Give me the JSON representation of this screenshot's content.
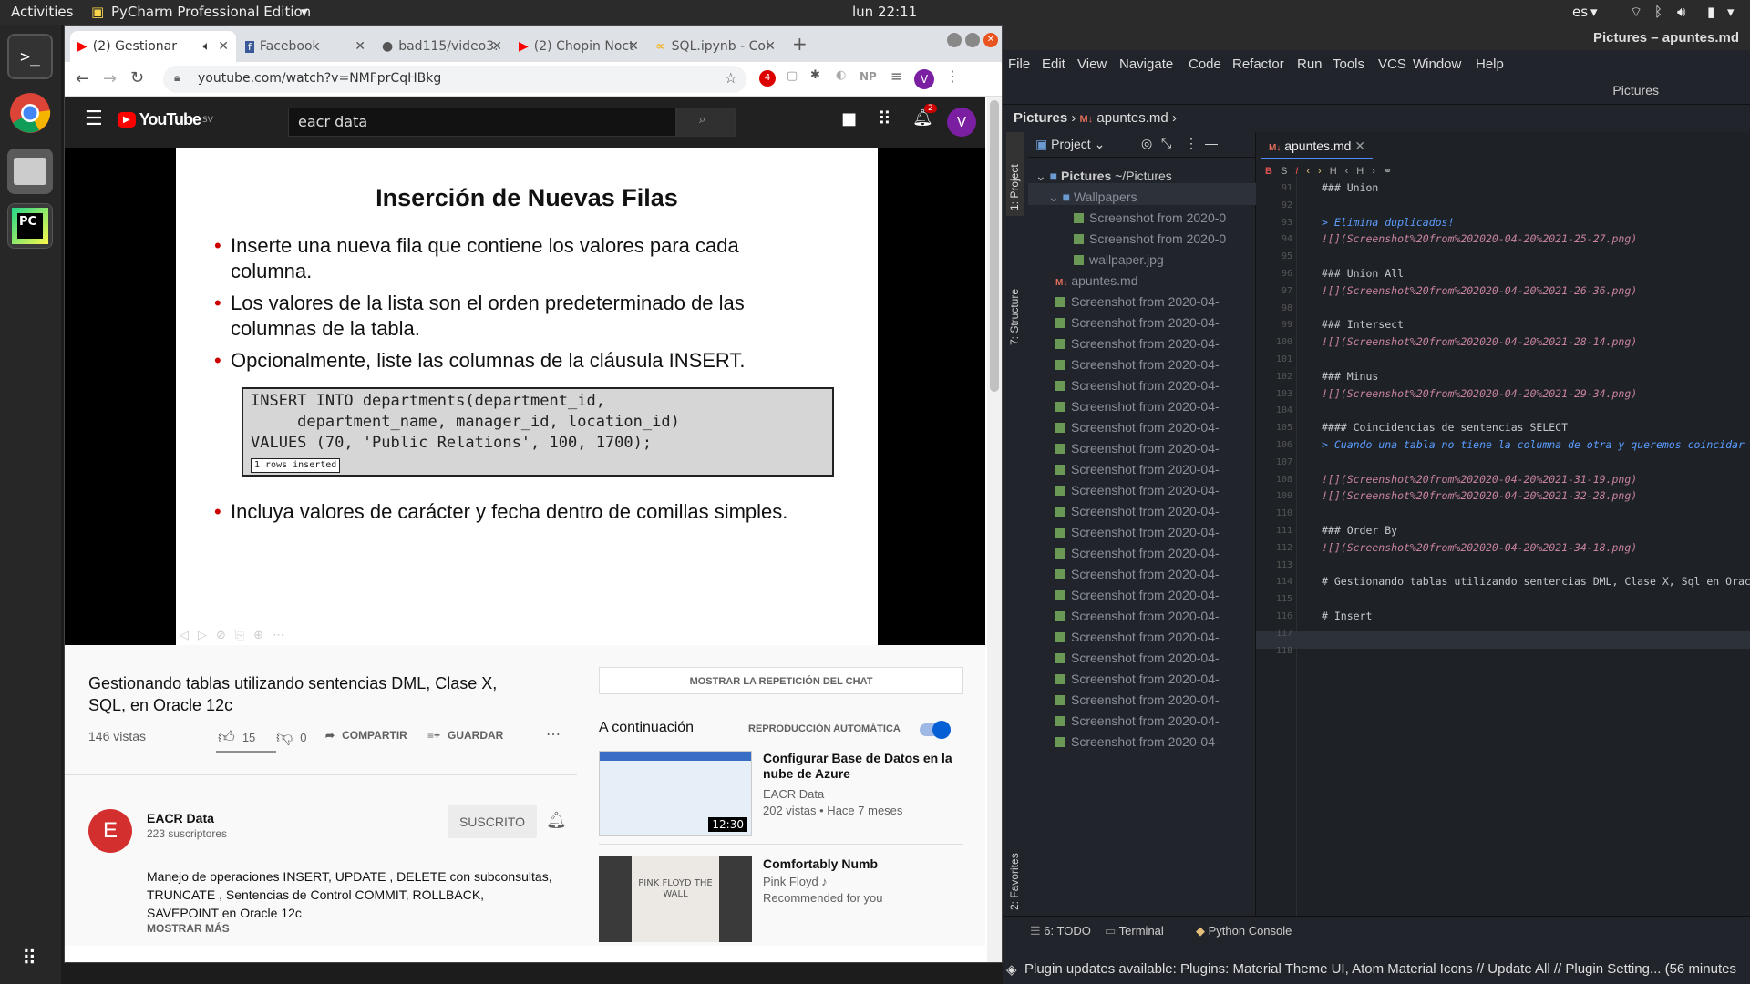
{
  "topbar": {
    "activities": "Activities",
    "app": "PyCharm Professional Edition",
    "clock": "lun 22:11",
    "lang": "es"
  },
  "chrome": {
    "tabs": [
      {
        "label": "(2) Gestionar"
      },
      {
        "label": "Facebook"
      },
      {
        "label": "bad115/video3."
      },
      {
        "label": "(2) Chopin Noct"
      },
      {
        "label": "SQL.ipynb - Col"
      }
    ],
    "url": "youtube.com/watch?v=NMFprCqHBkg",
    "ext_badge": "4",
    "ext_np": "NP",
    "avatar": "V"
  },
  "youtube": {
    "logo": "YouTube",
    "logo_sup": "SV",
    "search_value": "eacr data",
    "notif_count": "2",
    "slide": {
      "title": "Inserción de Nuevas Filas",
      "bullets": [
        "Inserte una nueva fila que contiene los valores para cada columna.",
        "Los valores de la lista son el orden predeterminado de las columnas de la tabla.",
        "Opcionalmente, liste las columnas de la cláusula INSERT."
      ],
      "code": "INSERT INTO departments(department_id,\n     department_name, manager_id, location_id)\nVALUES (70, 'Public Relations', 100, 1700);",
      "code_result": "1 rows inserted",
      "bullet4": "Incluya valores de carácter y fecha dentro de comillas simples."
    },
    "video_title": "Gestionando tablas utilizando sentencias DML, Clase X, SQL, en Oracle 12c",
    "views": "146 vistas",
    "likes": "15",
    "dislikes": "0",
    "share": "COMPARTIR",
    "save": "GUARDAR",
    "channel": {
      "initial": "E",
      "name": "EACR Data",
      "subs": "223 suscriptores",
      "subscribe": "SUSCRITO"
    },
    "description": "Manejo de operaciones INSERT, UPDATE , DELETE con subconsultas, TRUNCATE , Sentencias de Control COMMIT, ROLLBACK, SAVEPOINT en Oracle 12c",
    "show_more": "MOSTRAR MÁS",
    "chat_replay": "MOSTRAR LA REPETICIÓN DEL CHAT",
    "up_next": "A continuación",
    "autoplay": "REPRODUCCIÓN AUTOMÁTICA",
    "recs": [
      {
        "title": "Configurar Base de Datos en la nube de Azure",
        "channel": "EACR Data",
        "meta": "202 vistas • Hace 7 meses",
        "duration": "12:30"
      },
      {
        "title": "Comfortably Numb",
        "channel": "Pink Floyd ♪",
        "meta": "Recommended for you",
        "thumb_text": "PINK FLOYD THE WALL"
      }
    ]
  },
  "pycharm": {
    "window_title": "Pictures – apuntes.md",
    "menu": [
      "File",
      "Edit",
      "View",
      "Navigate",
      "Code",
      "Refactor",
      "Run",
      "Tools",
      "VCS",
      "Window",
      "Help"
    ],
    "subtitle": "Pictures",
    "breadcrumb": {
      "folder": "Pictures",
      "file": "apuntes.md"
    },
    "side_tabs": [
      "1: Project",
      "7: Structure",
      "2: Favorites"
    ],
    "project_label": "Project",
    "tree": {
      "root": "Pictures",
      "root_path": "~/Pictures",
      "wallpapers": "Wallpapers",
      "wall_items": [
        "Screenshot from 2020-0",
        "Screenshot from 2020-0",
        "wallpaper.jpg"
      ],
      "md": "apuntes.md",
      "shots": [
        "Screenshot from 2020-04-",
        "Screenshot from 2020-04-",
        "Screenshot from 2020-04-",
        "Screenshot from 2020-04-",
        "Screenshot from 2020-04-",
        "Screenshot from 2020-04-",
        "Screenshot from 2020-04-",
        "Screenshot from 2020-04-",
        "Screenshot from 2020-04-",
        "Screenshot from 2020-04-",
        "Screenshot from 2020-04-",
        "Screenshot from 2020-04-",
        "Screenshot from 2020-04-",
        "Screenshot from 2020-04-",
        "Screenshot from 2020-04-",
        "Screenshot from 2020-04-",
        "Screenshot from 2020-04-",
        "Screenshot from 2020-04-",
        "Screenshot from 2020-04-",
        "Screenshot from 2020-04-",
        "Screenshot from 2020-04-",
        "Screenshot from 2020-04-"
      ]
    },
    "editor_tab": "apuntes.md",
    "lines": [
      {
        "n": "91",
        "t": "### Union",
        "c": "hd"
      },
      {
        "n": "92",
        "t": "",
        "c": "hd"
      },
      {
        "n": "93",
        "t": "> Elimina duplicados!",
        "c": "qt"
      },
      {
        "n": "94",
        "t": "![](Screenshot%20from%202020-04-20%2021-25-27.png)",
        "c": "lk"
      },
      {
        "n": "95",
        "t": "",
        "c": "hd"
      },
      {
        "n": "96",
        "t": "### Union All",
        "c": "hd"
      },
      {
        "n": "97",
        "t": "![](Screenshot%20from%202020-04-20%2021-26-36.png)",
        "c": "lk"
      },
      {
        "n": "98",
        "t": "",
        "c": "hd"
      },
      {
        "n": "99",
        "t": "### Intersect",
        "c": "hd"
      },
      {
        "n": "100",
        "t": "![](Screenshot%20from%202020-04-20%2021-28-14.png)",
        "c": "lk"
      },
      {
        "n": "101",
        "t": "",
        "c": "hd"
      },
      {
        "n": "102",
        "t": "### Minus",
        "c": "hd"
      },
      {
        "n": "103",
        "t": "![](Screenshot%20from%202020-04-20%2021-29-34.png)",
        "c": "lk"
      },
      {
        "n": "104",
        "t": "",
        "c": "hd"
      },
      {
        "n": "105",
        "t": "#### Coincidencias de sentencias SELECT",
        "c": "hd"
      },
      {
        "n": "106",
        "t": "> Cuando una tabla no tiene la columna de otra y queremos coincidar",
        "c": "qt"
      },
      {
        "n": "107",
        "t": "",
        "c": "hd"
      },
      {
        "n": "108",
        "t": "![](Screenshot%20from%202020-04-20%2021-31-19.png)",
        "c": "lk"
      },
      {
        "n": "109",
        "t": "![](Screenshot%20from%202020-04-20%2021-32-28.png)",
        "c": "lk"
      },
      {
        "n": "110",
        "t": "",
        "c": "hd"
      },
      {
        "n": "111",
        "t": "### Order By",
        "c": "hd"
      },
      {
        "n": "112",
        "t": "![](Screenshot%20from%202020-04-20%2021-34-18.png)",
        "c": "lk"
      },
      {
        "n": "113",
        "t": "",
        "c": "hd"
      },
      {
        "n": "114",
        "t": "# Gestionando tablas utilizando sentencias DML, Clase X, Sql en Oracle",
        "c": "hd"
      },
      {
        "n": "115",
        "t": "",
        "c": "hd"
      },
      {
        "n": "116",
        "t": "# Insert",
        "c": "hd"
      },
      {
        "n": "117",
        "t": "",
        "c": "hd"
      },
      {
        "n": "118",
        "t": "",
        "c": "hd"
      }
    ],
    "bottom_tabs": [
      "6: TODO",
      "Terminal",
      "Python Console"
    ],
    "status": "Plugin updates available: Plugins: Material Theme UI, Atom Material Icons // Update All // Plugin Setting... (56 minutes"
  }
}
